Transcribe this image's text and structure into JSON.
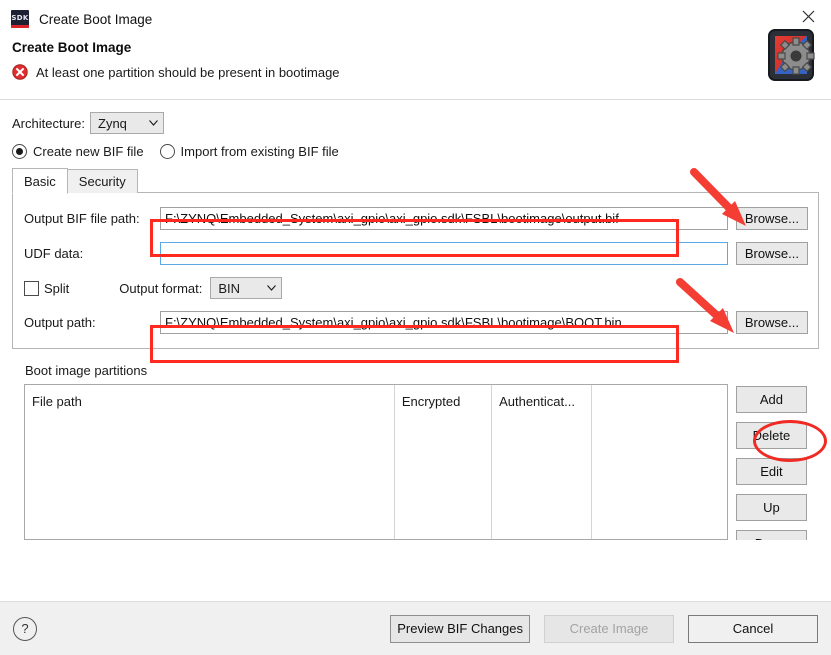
{
  "window": {
    "title": "Create Boot Image",
    "app_icon": "sdk-icon",
    "close_label": "close-icon"
  },
  "header": {
    "title": "Create Boot Image",
    "message": "At least one partition should be present in bootimage",
    "error_icon": "error-icon",
    "logo_icon": "sdk-board-gear-icon"
  },
  "architecture": {
    "label": "Architecture:",
    "value": "Zynq",
    "options": [
      "Zynq"
    ]
  },
  "bif_mode": {
    "options": [
      {
        "label": "Create new BIF file",
        "checked": true
      },
      {
        "label": "Import from existing BIF file",
        "checked": false
      }
    ]
  },
  "tabs": [
    {
      "label": "Basic",
      "active": true
    },
    {
      "label": "Security",
      "active": false
    }
  ],
  "basic": {
    "output_bif": {
      "label": "Output BIF file path:",
      "value": "F:\\ZYNQ\\Embedded_System\\axi_gpio\\axi_gpio.sdk\\FSBL\\bootimage\\output.bif",
      "placeholder": "",
      "browse_label": "Browse...",
      "focused": false
    },
    "udf_data": {
      "label": "UDF data:",
      "value": "",
      "placeholder": "",
      "browse_label": "Browse...",
      "focused": true
    },
    "split": {
      "label": "Split",
      "checked": false
    },
    "output_format": {
      "label": "Output format:",
      "value": "BIN",
      "options": [
        "BIN"
      ]
    },
    "output_path": {
      "label": "Output path:",
      "value": "F:\\ZYNQ\\Embedded_System\\axi_gpio\\axi_gpio.sdk\\FSBL\\bootimage\\BOOT.bin",
      "placeholder": "",
      "browse_label": "Browse...",
      "focused": false
    }
  },
  "partitions": {
    "label": "Boot image partitions",
    "columns": [
      "File path",
      "Encrypted",
      "Authenticat...",
      ""
    ],
    "rows": [],
    "buttons": [
      "Add",
      "Delete",
      "Edit",
      "Up",
      "Down"
    ]
  },
  "footer": {
    "help_label": "?",
    "preview_label": "Preview BIF Changes",
    "create_label": "Create Image",
    "create_disabled": true,
    "cancel_label": "Cancel"
  },
  "annotations": {
    "highlight_color": "#ff2a1f",
    "arrow_color": "#f43d33",
    "marks": [
      "red-rect-output-bif",
      "red-rect-output-path",
      "red-arrow-browse-bif",
      "red-arrow-browse-path",
      "red-ellipse-add-button"
    ]
  }
}
